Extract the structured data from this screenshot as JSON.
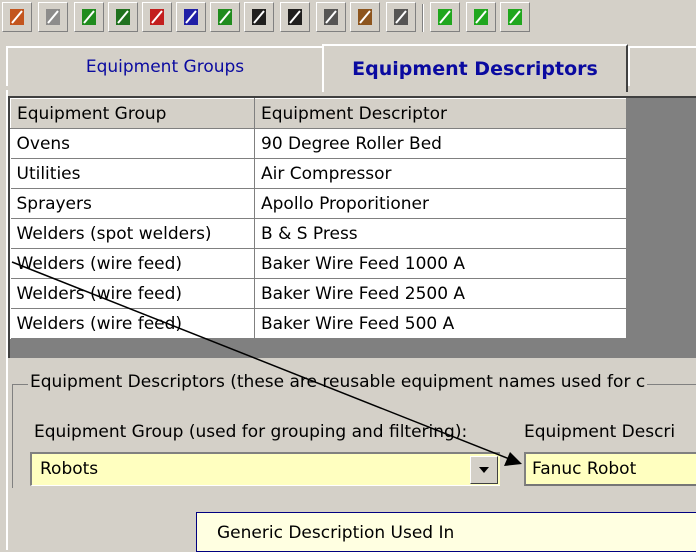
{
  "toolbar": {
    "buttons": [
      {
        "name": "import-icon",
        "color": "#c04000"
      },
      {
        "name": "cylinder-icon",
        "color": "#808080"
      },
      {
        "name": "green-arrow-icon",
        "color": "#008000"
      },
      {
        "name": "dark-green-arrow-icon",
        "color": "#006000"
      },
      {
        "name": "red-arrow-icon",
        "color": "#c00000"
      },
      {
        "name": "blue-arrow-icon",
        "color": "#0000a0"
      },
      {
        "name": "green-tree-icon",
        "color": "#008000"
      },
      {
        "name": "stand-icon",
        "color": "#000000"
      },
      {
        "name": "chart-icon",
        "color": "#000000"
      },
      {
        "name": "wrench-icon",
        "color": "#404040"
      },
      {
        "name": "gear-person-icon",
        "color": "#804000"
      },
      {
        "name": "tray-icon",
        "color": "#404040"
      },
      {
        "name": "green-column-icon",
        "color": "#00a000"
      },
      {
        "name": "green-stand-icon",
        "color": "#00a000"
      },
      {
        "name": "green-chart-icon",
        "color": "#00a000"
      }
    ]
  },
  "tabs": {
    "groups": "Equipment Groups",
    "descriptors": "Equipment Descriptors"
  },
  "grid": {
    "headers": [
      "Equipment Group",
      "Equipment Descriptor"
    ],
    "rows": [
      [
        "Ovens",
        "90 Degree Roller Bed"
      ],
      [
        "Utilities",
        "Air Compressor"
      ],
      [
        "Sprayers",
        "Apollo Proporitioner"
      ],
      [
        "Welders (spot welders)",
        "B & S Press"
      ],
      [
        "Welders (wire feed)",
        "Baker Wire Feed 1000 A"
      ],
      [
        "Welders (wire feed)",
        "Baker Wire Feed 2500 A"
      ],
      [
        "Welders (wire feed)",
        "Baker Wire Feed 500 A"
      ]
    ]
  },
  "form": {
    "legend": "Equipment Descriptors (these are reusable equipment names used for c",
    "group_label": "Equipment Group (used for grouping and filtering):",
    "group_value": "Robots",
    "descriptor_label": "Equipment Descri",
    "descriptor_value": "Fanuc Robot"
  },
  "tooltip": "Generic Description Used In",
  "colors": {
    "field_bg": "#ffffc0",
    "tab_text": "#0a0aa0",
    "grid_empty": "#808080"
  }
}
